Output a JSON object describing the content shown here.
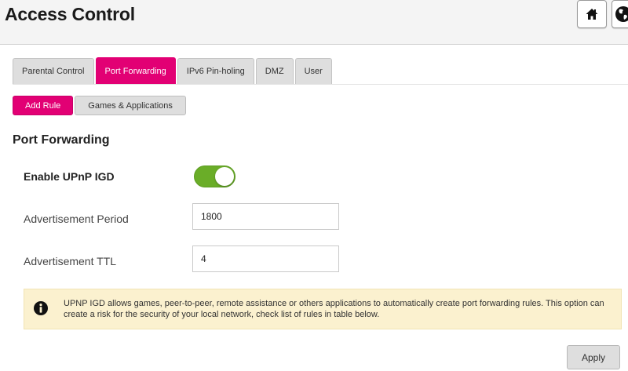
{
  "header": {
    "title": "Access Control",
    "home_icon": "home-icon",
    "globe_icon": "globe-icon"
  },
  "tabs": [
    {
      "label": "Parental Control",
      "active": false
    },
    {
      "label": "Port Forwarding",
      "active": true
    },
    {
      "label": "IPv6 Pin-holing",
      "active": false
    },
    {
      "label": "DMZ",
      "active": false
    },
    {
      "label": "User",
      "active": false
    }
  ],
  "subtabs": [
    {
      "label": "Add Rule",
      "active": true
    },
    {
      "label": "Games & Applications",
      "active": false
    }
  ],
  "section": {
    "title": "Port Forwarding"
  },
  "form": {
    "upnp_label": "Enable UPnP IGD",
    "upnp_enabled": true,
    "period_label": "Advertisement Period",
    "period_value": "1800",
    "ttl_label": "Advertisement TTL",
    "ttl_value": "4"
  },
  "notice": {
    "text": "UPNP IGD allows games, peer-to-peer, remote assistance or others applications to automatically create port forwarding rules. This option can create a risk for the security of your local network, check list of rules in table below.",
    "icon": "info-icon"
  },
  "actions": {
    "apply_label": "Apply"
  },
  "colors": {
    "accent": "#e20074",
    "toggle_on": "#6aad28",
    "notice_bg": "#fbf1cf"
  }
}
